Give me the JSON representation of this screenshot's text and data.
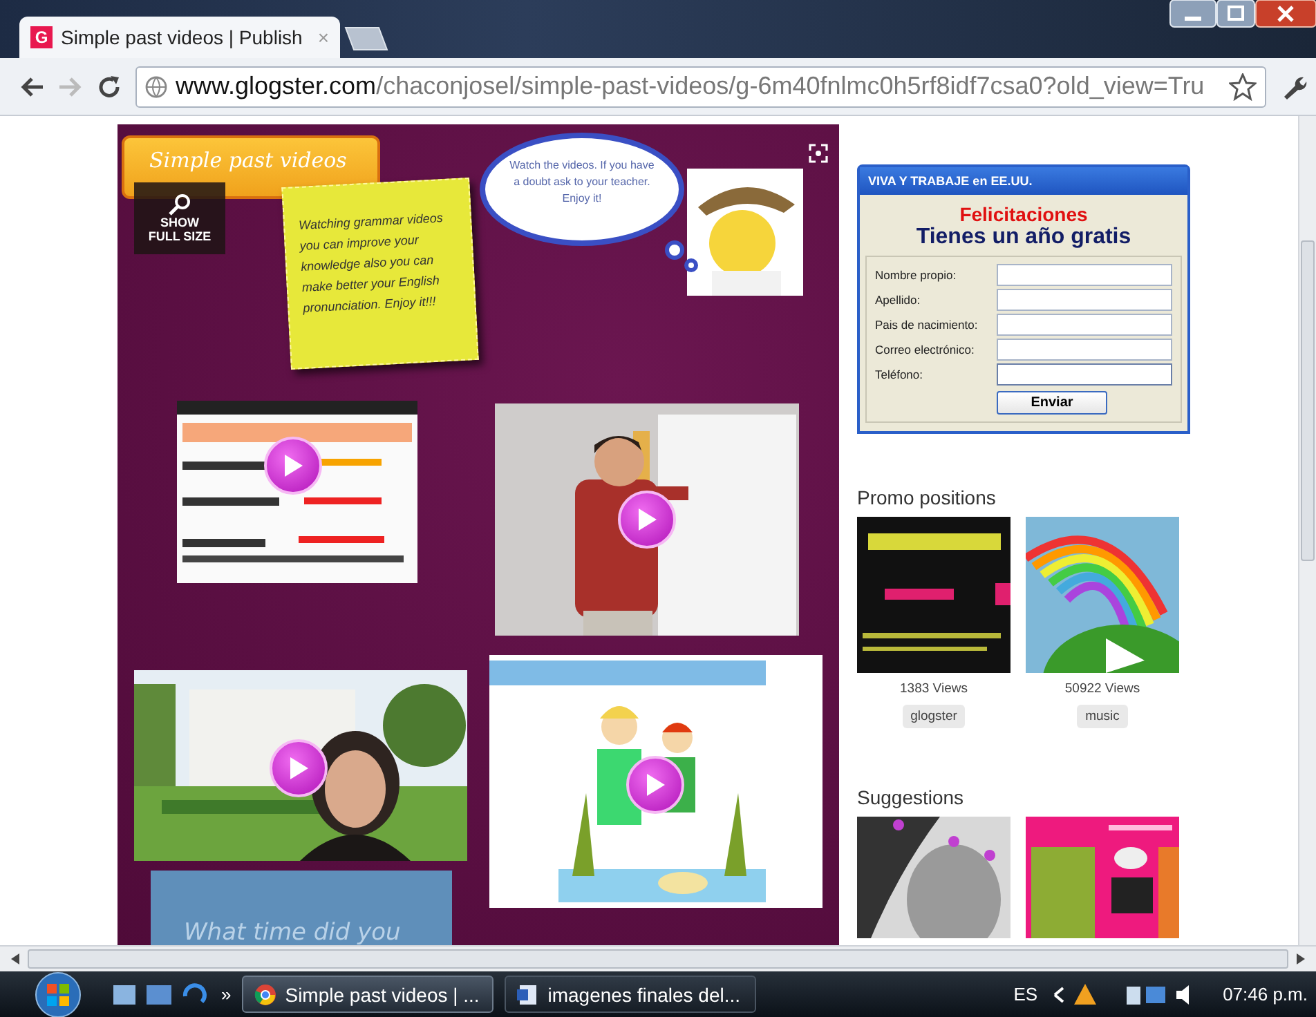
{
  "browser": {
    "tab": {
      "favicon": "G",
      "title": "Simple past videos | Publish",
      "close": "×",
      "selected": true
    },
    "url": {
      "host": "www.glogster.com",
      "path": "/chaconjosel/simple-past-videos/g-6m40fnlmc0h5rf8idf7csa0?old_view=Tru"
    }
  },
  "glog": {
    "title": "Simple past videos",
    "zoom_label": [
      "SHOW",
      "FULL SIZE"
    ],
    "note": "Watching grammar videos you can improve your knowledge also you can make better your English pronunciation. Enjoy it!!!",
    "cloud": "Watch the videos. If you have a doubt ask to your teacher. Enjoy it!",
    "caption": "What time did you"
  },
  "ad": {
    "header": "VIVA Y TRABAJE en EE.UU.",
    "headline": "Felicitaciones",
    "subhead": "Tienes un año gratis",
    "fields": [
      {
        "label": "Nombre propio:",
        "focused": false
      },
      {
        "label": "Apellido:",
        "focused": false
      },
      {
        "label": "Pais de nacimiento:",
        "focused": false
      },
      {
        "label": "Correo electrónico:",
        "focused": false
      },
      {
        "label": "Teléfono:",
        "focused": true
      }
    ],
    "button": "Enviar"
  },
  "promo": {
    "title": "Promo positions",
    "items": [
      {
        "views": "1383 Views",
        "tag": "glogster"
      },
      {
        "views": "50922 Views",
        "tag": "music"
      }
    ]
  },
  "suggestions": {
    "title": "Suggestions"
  },
  "taskbar": {
    "overflow": "»",
    "tasks": [
      {
        "label": "Simple past videos | ...",
        "selected": true
      },
      {
        "label": "imagenes finales del...",
        "selected": false
      }
    ],
    "language": "ES",
    "time": "07:46 p.m."
  }
}
